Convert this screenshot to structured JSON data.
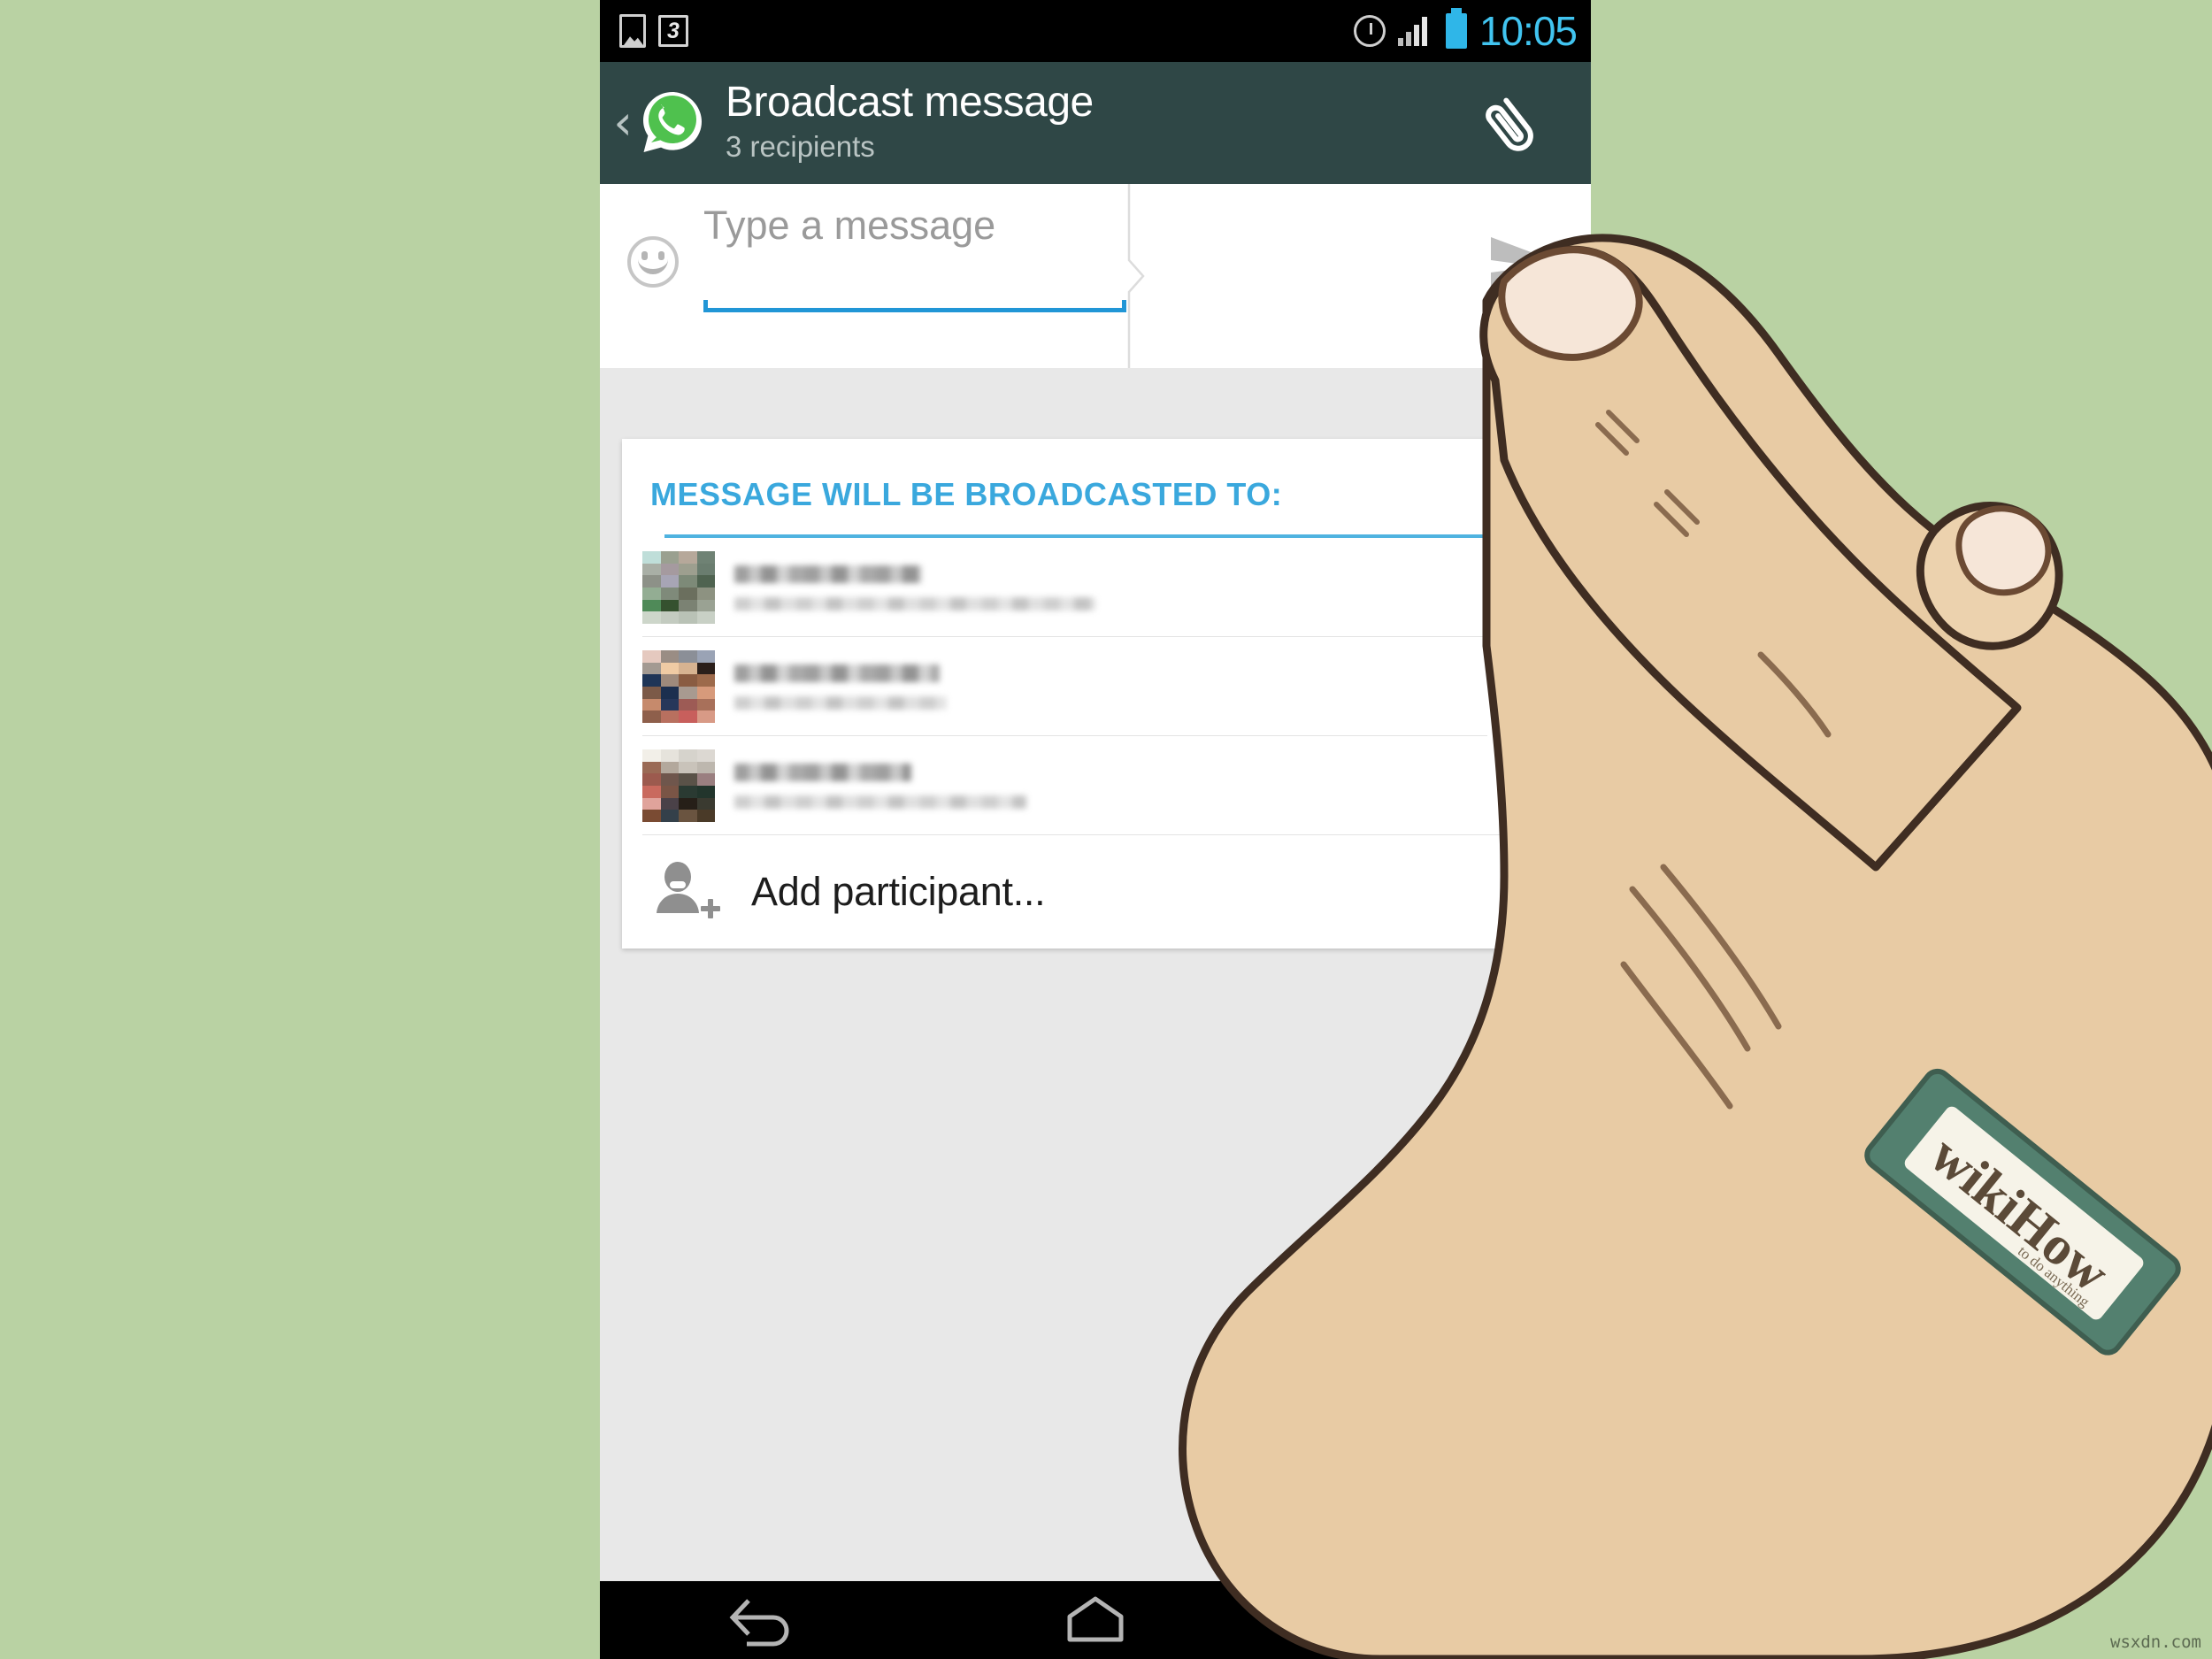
{
  "status_bar": {
    "clock": "10:05",
    "icons": [
      "gallery-icon",
      "badge-3-icon",
      "alarm-icon",
      "signal-icon",
      "battery-icon"
    ],
    "badge_label": "3",
    "clock_color": "#41c4f0",
    "battery_color": "#2fb6e8"
  },
  "app_bar": {
    "back_label": "‹",
    "title": "Broadcast message",
    "subtitle": "3 recipients",
    "attach_icon": "paperclip-icon",
    "logo_icon": "whatsapp-logo-icon",
    "bg_color": "#2f4746",
    "title_color": "#ffffff",
    "subtitle_color": "#b9c4c3"
  },
  "compose": {
    "emoji_icon": "emoji-smiley-icon",
    "input_value": "",
    "placeholder": "Type a message",
    "send_icon": "send-paper-plane-icon",
    "underline_color": "#2196d6",
    "placeholder_color": "#9a9a9a"
  },
  "card": {
    "header": "MESSAGE WILL BE BROADCASTED TO:",
    "header_color": "#3aa8dd",
    "rule_color": "#4fb3e0",
    "recipients": [
      {
        "name": "",
        "status": "",
        "name_redacted": true,
        "status_redacted": true,
        "name_width": 212,
        "status_width": 408,
        "avatar_colors": [
          "#bfded9",
          "#9aa090",
          "#b6a89a",
          "#6f8274",
          "#a9afa6",
          "#a59a9f",
          "#9d9f8f",
          "#6a7d6f",
          "#8d9188",
          "#a7a5b5",
          "#7d8a78",
          "#4f6350",
          "#93ad93",
          "#7f8a7a",
          "#6b6f5e",
          "#8d9281",
          "#4f8a58",
          "#35512f",
          "#7b8273",
          "#9aa293",
          "#cdd6ca",
          "#c3cbc0",
          "#b9c2b6",
          "#c8d0c5"
        ],
        "remove_icon": "close-icon"
      },
      {
        "name": "",
        "status": "",
        "name_redacted": true,
        "status_redacted": true,
        "name_width": 232,
        "status_width": 240,
        "avatar_colors": [
          "#e5c9bf",
          "#9a8d84",
          "#8b8f97",
          "#9aa3b5",
          "#a39a92",
          "#f0cba4",
          "#d7b391",
          "#2b1f1a",
          "#1f3557",
          "#9e8a7c",
          "#8a5c42",
          "#9d6a4b",
          "#7c5a48",
          "#1c2f4f",
          "#a89a90",
          "#d79a7b",
          "#c68a6c",
          "#27375a",
          "#9d5b55",
          "#a8705a",
          "#8e5f4b",
          "#b8705f",
          "#c85f5c",
          "#d89a86"
        ],
        "remove_icon": "close-icon"
      },
      {
        "name": "",
        "status": "",
        "name_redacted": true,
        "status_redacted": true,
        "name_width": 200,
        "status_width": 330,
        "avatar_colors": [
          "#f2efe8",
          "#e6e3dc",
          "#d6d3cc",
          "#dcd8d2",
          "#9a6a55",
          "#b3a89c",
          "#c9c3ba",
          "#bdb7ae",
          "#9c5a4e",
          "#6f564c",
          "#5a5248",
          "#9a7f80",
          "#c96a5e",
          "#7a5546",
          "#2a3a32",
          "#22352c",
          "#e0a39b",
          "#4a4148",
          "#261f18",
          "#3a3a30",
          "#7a4b33",
          "#34404a",
          "#6a5440",
          "#4a3a28"
        ],
        "remove_icon": "close-icon"
      }
    ],
    "add_participant_label": "Add participant...",
    "add_participant_icon": "person-add-icon"
  },
  "nav_bar": {
    "buttons": [
      {
        "name": "back-nav-button",
        "icon": "nav-back-icon"
      },
      {
        "name": "home-nav-button",
        "icon": "nav-home-icon"
      },
      {
        "name": "recents-nav-button",
        "icon": "nav-recents-icon"
      }
    ]
  },
  "illustration": {
    "hand_icon": "pointing-hand-illustration",
    "wristband_label": "wikiHow",
    "wristband_tagline": "to do anything",
    "skin_color": "#e8cba4",
    "nail_color": "#f6e6d8",
    "outline_color": "#3f2d22",
    "band_color": "#53806f"
  },
  "background": {
    "color": "#b9d2a3"
  },
  "watermark": {
    "text": "wsxdn.com"
  }
}
